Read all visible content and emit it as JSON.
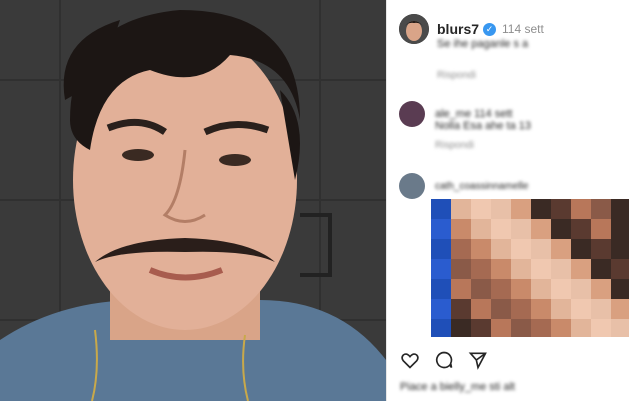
{
  "post": {
    "username": "blurs7",
    "verified_icon": "verified-check-icon",
    "time": "114 sett",
    "caption_blurred": "Se ihe paganle s a",
    "reply_blurred": "Rispondi"
  },
  "comment1": {
    "user_blurred": "ale_me 114 sett",
    "text_blurred": "Nolla Esa ahe ta 13",
    "reply_blurred": "Rispondi"
  },
  "comment2": {
    "user_blurred": "cath_coassinnamelle"
  },
  "actions": {
    "like_icon": "heart-icon",
    "comment_icon": "comment-icon",
    "share_icon": "share-icon"
  },
  "likes_blurred": "Piace a bielly_me sti alt"
}
